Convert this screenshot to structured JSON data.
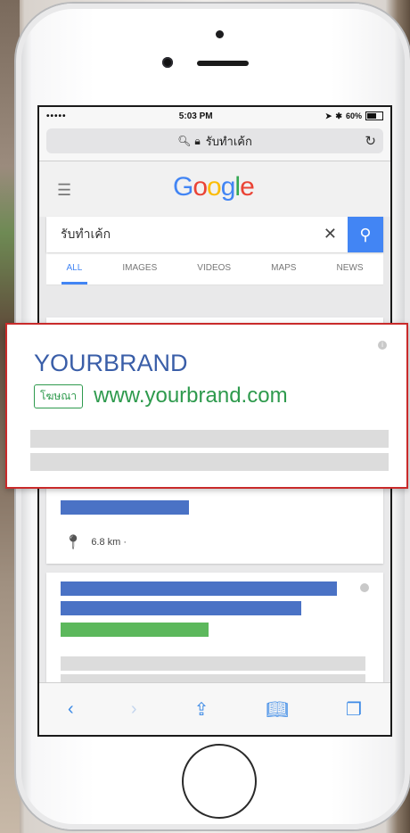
{
  "status": {
    "carrier": "•••••",
    "time": "5:03 PM",
    "battery": "60%"
  },
  "url": {
    "text": "รับทำเค้ก"
  },
  "google": {
    "logo": "Google"
  },
  "search": {
    "query": "รับทำเค้ก",
    "clear_icon": "close-icon",
    "button_icon": "search-icon"
  },
  "tabs": [
    "ALL",
    "IMAGES",
    "VIDEOS",
    "MAPS",
    "NEWS"
  ],
  "ad": {
    "brand": "YOURBRAND",
    "badge": "โฆษณา",
    "url": "www.yourbrand.com"
  },
  "local": {
    "distance": "6.8 km ·"
  },
  "colors": {
    "ad_border": "#c92a2a",
    "brand_blue": "#3a5ea8",
    "ad_green": "#2e9a4d",
    "google_blue": "#4285f4"
  }
}
